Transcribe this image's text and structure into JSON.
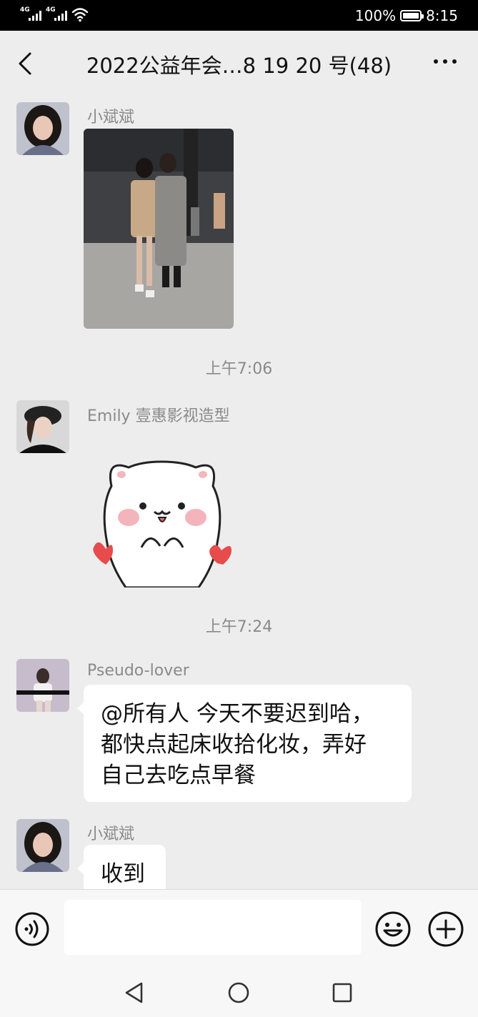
{
  "status_bar": {
    "signal1_label": "4G",
    "signal2_label": "4G",
    "battery": "100%",
    "time": "8:15"
  },
  "header": {
    "title": "2022公益年会…8 19 20 号(48)"
  },
  "messages": [
    {
      "sender": "小斌斌",
      "type": "image"
    },
    {
      "type": "time",
      "text": "上午7:06"
    },
    {
      "sender": "Emily 壹惠影视造型",
      "type": "sticker"
    },
    {
      "type": "time",
      "text": "上午7:24"
    },
    {
      "sender": "Pseudo-lover",
      "type": "text",
      "lines": [
        "@所有人  今天不要迟到哈，",
        "都快点起床收拾化妆，弄好",
        "自己去吃点早餐"
      ]
    },
    {
      "sender": "小斌斌",
      "type": "text",
      "lines": [
        "收到"
      ]
    }
  ],
  "input": {
    "value": "",
    "placeholder": ""
  },
  "icons": {
    "back": "chevron-left-icon",
    "more": "more-dots-icon",
    "voice": "voice-icon",
    "emoji": "smiley-icon",
    "plus": "plus-icon",
    "nav_back": "triangle-back-icon",
    "nav_home": "circle-home-icon",
    "nav_recent": "square-recent-icon"
  },
  "colors": {
    "background": "#ededed",
    "bubble": "#ffffff",
    "meta_text": "#8a8a8a",
    "status_bar": "#000000"
  }
}
